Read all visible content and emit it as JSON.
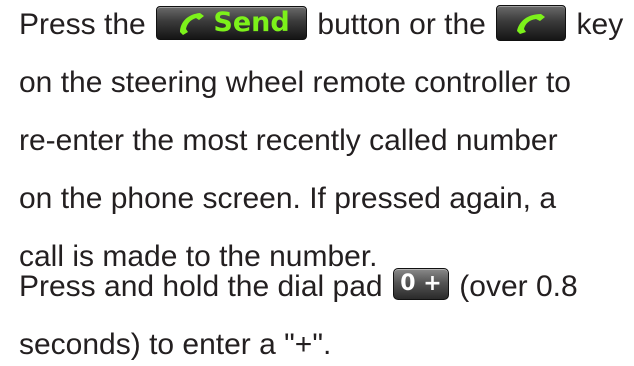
{
  "paragraph1": {
    "line1_before": "Press the ",
    "send_button_label": "Send",
    "line1_middle": " button or the ",
    "line1_after": " key",
    "line2": "on the steering wheel remote controller to",
    "line3": "re-enter the most recently called number",
    "line4": "on the phone screen. If pressed again, a",
    "line5": "call is made to the number."
  },
  "paragraph2": {
    "line1_before": "Press and hold the dial pad ",
    "zero_key_label": "0 +",
    "line1_after": " (over 0.8",
    "line2": "seconds) to enter a \"+\"."
  },
  "colors": {
    "text": "#231f20",
    "send_green": "#7cf21a",
    "button_dark": "#2a2a2a"
  },
  "icons": {
    "send_button_icon": "phone-handset-icon",
    "call_key_icon": "phone-handset-icon"
  }
}
